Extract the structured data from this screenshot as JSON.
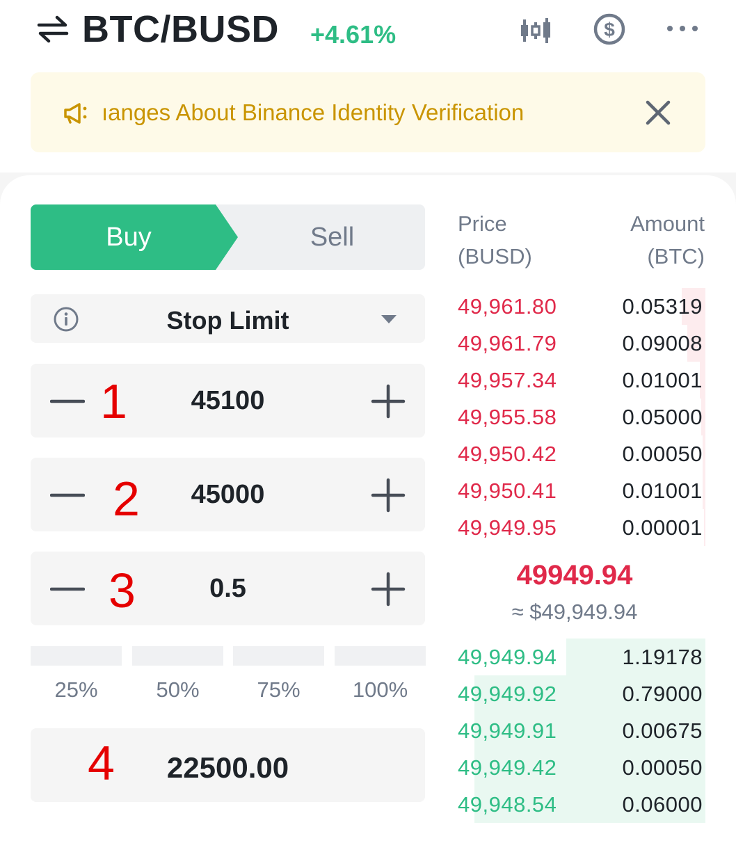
{
  "header": {
    "pair": "BTC/BUSD",
    "change": "+4.61%",
    "accent_up": "#2ebd85",
    "accent_down": "#e0294a"
  },
  "banner": {
    "text": "ıanges About Binance Identity Verification"
  },
  "trade": {
    "buy_label": "Buy",
    "sell_label": "Sell",
    "order_type": "Stop Limit",
    "stop_value": "45100",
    "limit_value": "45000",
    "amount_value": "0.5",
    "total_value": "22500.00",
    "percentages": [
      "25%",
      "50%",
      "75%",
      "100%"
    ],
    "annotations": [
      "1",
      "2",
      "3",
      "4"
    ]
  },
  "orderbook": {
    "price_header_1": "Price",
    "price_header_2": "(BUSD)",
    "amount_header_1": "Amount",
    "amount_header_2": "(BTC)",
    "asks": [
      {
        "price": "49,961.80",
        "amount": "0.05319"
      },
      {
        "price": "49,961.79",
        "amount": "0.09008"
      },
      {
        "price": "49,957.34",
        "amount": "0.01001"
      },
      {
        "price": "49,955.58",
        "amount": "0.05000"
      },
      {
        "price": "49,950.42",
        "amount": "0.00050"
      },
      {
        "price": "49,950.41",
        "amount": "0.01001"
      },
      {
        "price": "49,949.95",
        "amount": "0.00001"
      }
    ],
    "last_price": "49949.94",
    "last_price_usd": "≈ $49,949.94",
    "bids": [
      {
        "price": "49,949.94",
        "amount": "1.19178"
      },
      {
        "price": "49,949.92",
        "amount": "0.79000"
      },
      {
        "price": "49,949.91",
        "amount": "0.00675"
      },
      {
        "price": "49,949.42",
        "amount": "0.00050"
      },
      {
        "price": "49,948.54",
        "amount": "0.06000"
      }
    ]
  }
}
